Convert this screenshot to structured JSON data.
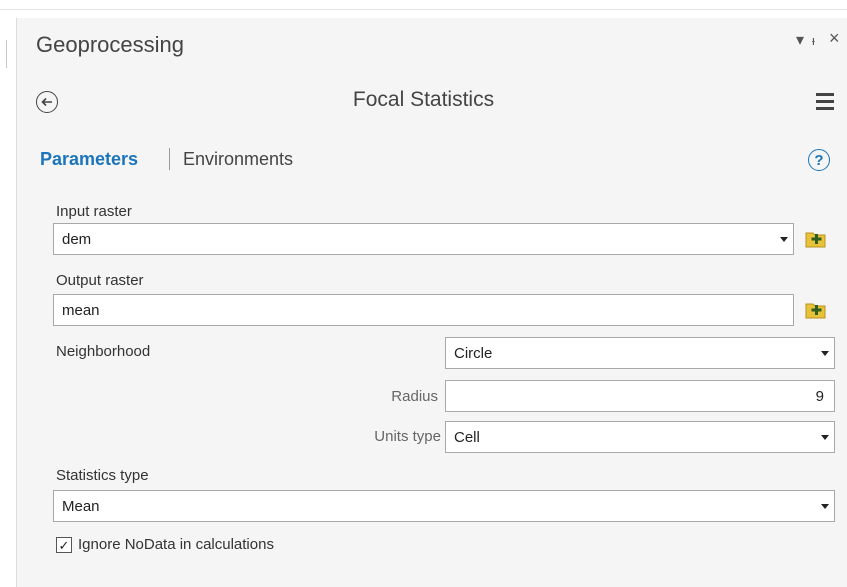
{
  "window": {
    "title": "Geoprocessing",
    "controls": {
      "options": "▾",
      "pin": "ᵼ",
      "close": "×"
    }
  },
  "tool": {
    "title": "Focal Statistics"
  },
  "tabs": {
    "parameters": "Parameters",
    "environments": "Environments"
  },
  "help_symbol": "?",
  "fields": {
    "input_raster": {
      "label": "Input raster",
      "value": "dem"
    },
    "output_raster": {
      "label": "Output raster",
      "value": "mean"
    },
    "neighborhood": {
      "label": "Neighborhood",
      "value": "Circle"
    },
    "radius": {
      "label": "Radius",
      "value": "9"
    },
    "units_type": {
      "label": "Units type",
      "value": "Cell"
    },
    "statistics_type": {
      "label": "Statistics type",
      "value": "Mean"
    },
    "ignore_nodata": {
      "label": "Ignore NoData in calculations",
      "checked": true,
      "mark": "✓"
    }
  },
  "icons": {
    "back": "back-arrow-icon",
    "menu": "hamburger-menu-icon",
    "help": "help-icon",
    "browse": "folder-browse-icon"
  },
  "colors": {
    "accent": "#1b75bb",
    "panel": "#f5f5f5",
    "folder": "#e8c23a"
  }
}
